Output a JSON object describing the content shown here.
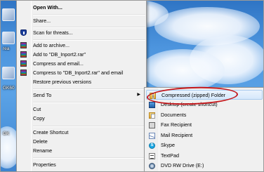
{
  "desktop": {
    "labels": [
      "rea",
      "GK60",
      "GK"
    ]
  },
  "context_menu": {
    "open_with": "Open With...",
    "share": "Share...",
    "scan": "Scan for threats...",
    "add_to_archive": "Add to archive...",
    "add_to_rar": "Add to \"DB_Inport2.rar\"",
    "compress_email": "Compress and email...",
    "compress_rar_email": "Compress to \"DB_Inport2.rar\" and email",
    "restore": "Restore previous versions",
    "send_to": "Send To",
    "cut": "Cut",
    "copy": "Copy",
    "create_shortcut": "Create Shortcut",
    "delete": "Delete",
    "rename": "Rename",
    "properties": "Properties",
    "submenu_arrow": "▶"
  },
  "send_to_menu": {
    "compressed_folder": "Compressed (zipped) Folder",
    "desktop": "Desktop (create shortcut)",
    "documents": "Documents",
    "fax": "Fax Recipient",
    "mail": "Mail Recipient",
    "skype": "Skype",
    "textpad": "TextPad",
    "dvd": "DVD RW Drive (E:)",
    "skype_glyph": "S"
  },
  "annotation": {
    "highlight_color": "#c4171b"
  },
  "icons": {
    "scan": "shield-icon",
    "winrar": "winrar-archive-icon",
    "zip": "zip-folder-icon"
  }
}
